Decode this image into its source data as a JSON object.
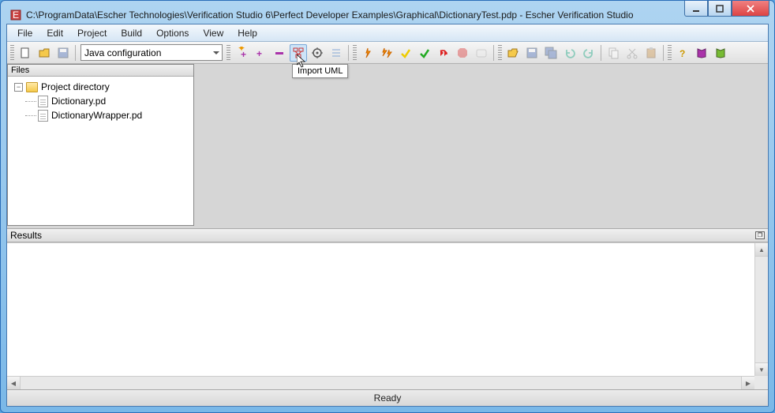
{
  "window": {
    "title": "C:\\ProgramData\\Escher Technologies\\Verification Studio 6\\Perfect Developer Examples\\Graphical\\DictionaryTest.pdp - Escher Verification Studio"
  },
  "menu": [
    "File",
    "Edit",
    "Project",
    "Build",
    "Options",
    "View",
    "Help"
  ],
  "toolbar": {
    "config_select": "Java configuration",
    "tooltip": "Import UML"
  },
  "panels": {
    "files_title": "Files",
    "results_title": "Results"
  },
  "tree": {
    "root": "Project directory",
    "items": [
      "Dictionary.pd",
      "DictionaryWrapper.pd"
    ]
  },
  "status": "Ready"
}
